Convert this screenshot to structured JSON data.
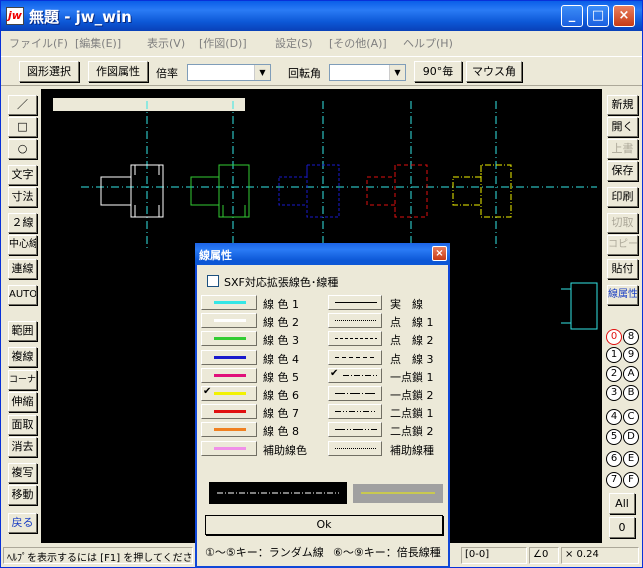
{
  "window": {
    "title": "無題 - jw_win",
    "icon": "jw",
    "buttons": {
      "minimize": "_",
      "maximize": "□",
      "close": "×"
    }
  },
  "menu": [
    "ファイル(F)",
    "[編集(E)]",
    "表示(V)",
    "[作図(D)]",
    "設定(S)",
    "[その他(A)]",
    "ヘルプ(H)"
  ],
  "toolbar": {
    "figure_select": "図形選択",
    "draw_attr": "作図属性",
    "scale_label": "倍率",
    "scale_value": "",
    "rotate_label": "回転角",
    "rotate_value": "",
    "deg90": "90°毎",
    "mouse_angle": "マウス角"
  },
  "left_tools": [
    "／",
    "□",
    "○",
    "文字",
    "寸法",
    "２線",
    "中心線",
    "連線",
    "AUTO",
    "範囲",
    "複線",
    "コーナー",
    "伸縮",
    "面取",
    "消去",
    "複写",
    "移動",
    "戻る"
  ],
  "right_tools": [
    "新規",
    "開く",
    "上書",
    "保存",
    "印刷",
    "切取",
    "コピー",
    "貼付",
    "線属性"
  ],
  "layer_buttons": [
    [
      "0",
      "8"
    ],
    [
      "1",
      "9"
    ],
    [
      "2",
      "A"
    ],
    [
      "3",
      "B"
    ],
    [
      "4",
      "C"
    ],
    [
      "5",
      "D"
    ],
    [
      "6",
      "E"
    ],
    [
      "7",
      "F"
    ]
  ],
  "layer_all": "All",
  "layer_zero": "0",
  "status": {
    "help": "ﾍﾙﾌﾟを表示するには [F1] を押してください",
    "coords": "[0-0]",
    "angle": "∠0",
    "scale": "× 0.24"
  },
  "dialog": {
    "title": "線属性",
    "close": "×",
    "sxf_label": "SXF対応拡張線色･線種",
    "colors": [
      {
        "label": "線 色 1",
        "color": "#33e6e6",
        "checked": false
      },
      {
        "label": "線 色 2",
        "color": "#ffffff",
        "checked": false
      },
      {
        "label": "線 色 3",
        "color": "#33cc33",
        "checked": false
      },
      {
        "label": "線 色 4",
        "color": "#1a1acc",
        "checked": false
      },
      {
        "label": "線 色 5",
        "color": "#e0107a",
        "checked": false
      },
      {
        "label": "線 色 6",
        "color": "#f2f200",
        "checked": true
      },
      {
        "label": "線 色 7",
        "color": "#e01010",
        "checked": false
      },
      {
        "label": "線 色 8",
        "color": "#f08020",
        "checked": false
      },
      {
        "label": "補助線色",
        "color": "#f090e8",
        "checked": false
      }
    ],
    "linetypes": [
      {
        "label": "実　線",
        "dash": "none",
        "checked": false
      },
      {
        "label": "点　線 1",
        "dash": "1,1",
        "checked": false
      },
      {
        "label": "点　線 2",
        "dash": "3,2",
        "checked": false
      },
      {
        "label": "点　線 3",
        "dash": "4,3",
        "checked": false
      },
      {
        "label": "一点鎖 1",
        "dash": "6,2,1,2",
        "checked": true
      },
      {
        "label": "一点鎖 2",
        "dash": "10,2,1,2",
        "checked": false
      },
      {
        "label": "二点鎖 1",
        "dash": "6,2,1,2,1,2",
        "checked": false
      },
      {
        "label": "二点鎖 2",
        "dash": "10,2,1,2,1,2",
        "checked": false
      },
      {
        "label": "補助線種",
        "dash": "1,1",
        "checked": false
      }
    ],
    "ok": "Ok",
    "hint_left": "①～⑤キー：ランダム線",
    "hint_right": "⑥～⑨キー：倍長線種"
  }
}
